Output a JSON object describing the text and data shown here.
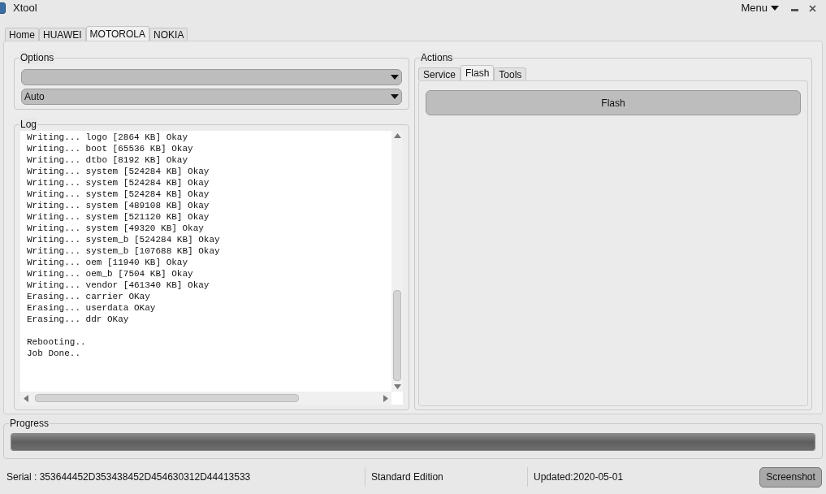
{
  "window": {
    "title": "Xtool",
    "menu": "Menu"
  },
  "tabs": [
    {
      "label": "Home",
      "selected": false
    },
    {
      "label": "HUAWEI",
      "selected": false
    },
    {
      "label": "MOTOROLA",
      "selected": true
    },
    {
      "label": "NOKIA",
      "selected": false
    }
  ],
  "options": {
    "title": "Options",
    "dropdowns": [
      {
        "kind": "blank"
      },
      {
        "kind": "filled",
        "value": "Auto"
      }
    ]
  },
  "log": {
    "title": "Log",
    "blocks": [
      [
        "Writing... logo [2864 KB] Okay",
        "Writing... boot [65536 KB] Okay",
        "Writing... dtbo [8192 KB] Okay",
        "Writing... system [524284 KB] Okay",
        "Writing... system [524284 KB] Okay",
        "Writing... system [524284 KB] Okay",
        "Writing... system [489108 KB] Okay",
        "Writing... system [521120 KB] Okay",
        "Writing... system [49320 KB] Okay",
        "Writing... system_b [524284 KB] Okay",
        "Writing... system_b [107688 KB] Okay",
        "Writing... oem [11940 KB] Okay",
        "Writing... oem_b [7504 KB] Okay",
        "Writing... vendor [461340 KB] Okay",
        "Erasing... carrier OKay",
        "Erasing... userdata OKay",
        "Erasing... ddr OKay"
      ],
      [
        "Rebooting..",
        "Job Done.."
      ]
    ]
  },
  "actions": {
    "title": "Actions",
    "tabs": [
      {
        "label": "Service",
        "selected": false
      },
      {
        "label": "Flash",
        "selected": true
      },
      {
        "label": "Tools",
        "selected": false
      }
    ],
    "button": "Flash"
  },
  "progress": {
    "title": "Progress",
    "level": 1
  },
  "status_bar": {
    "serial": "Serial : 353644452D353438452D454630312D44413533",
    "edition": "Standard Edition",
    "updated": "Updated:2020-05-01",
    "button": "Screenshot"
  }
}
